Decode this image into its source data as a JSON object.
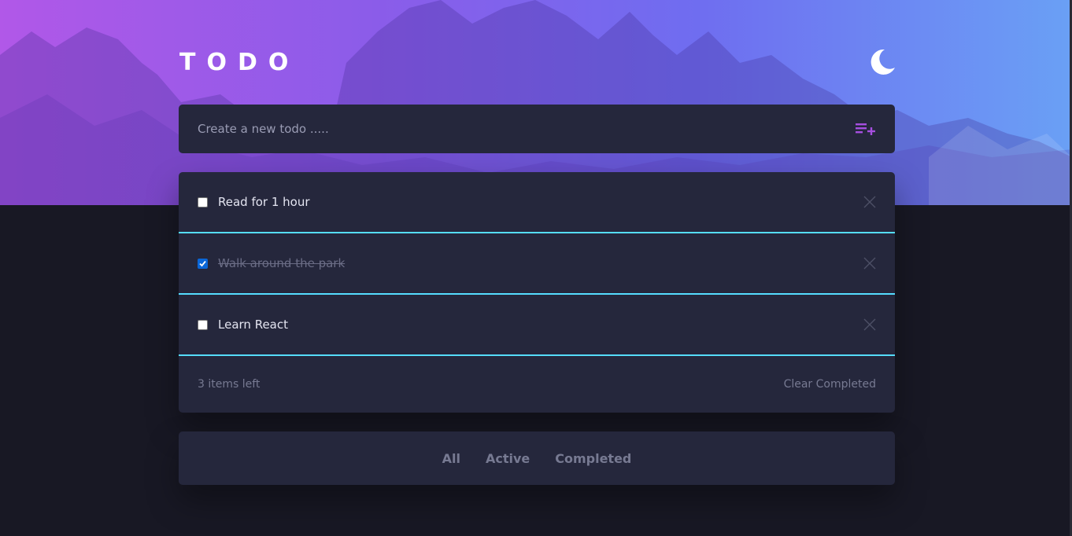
{
  "header": {
    "title": "TODO",
    "theme_icon": "moon-icon"
  },
  "new_todo": {
    "placeholder": "Create a new todo .....",
    "value": "",
    "add_icon": "playlist-add-icon"
  },
  "todos": [
    {
      "text": "Read for 1 hour",
      "completed": false
    },
    {
      "text": "Walk around the park",
      "completed": true
    },
    {
      "text": "Learn React",
      "completed": false
    }
  ],
  "footer": {
    "items_left": "3 items left",
    "clear_label": "Clear Completed"
  },
  "filters": [
    "All",
    "Active",
    "Completed"
  ],
  "colors": {
    "accent": "#55ddff",
    "card": "#25273c",
    "page": "#181824",
    "add_icon": "#a64fe0",
    "checkbox_checked": "#0a66d8"
  }
}
